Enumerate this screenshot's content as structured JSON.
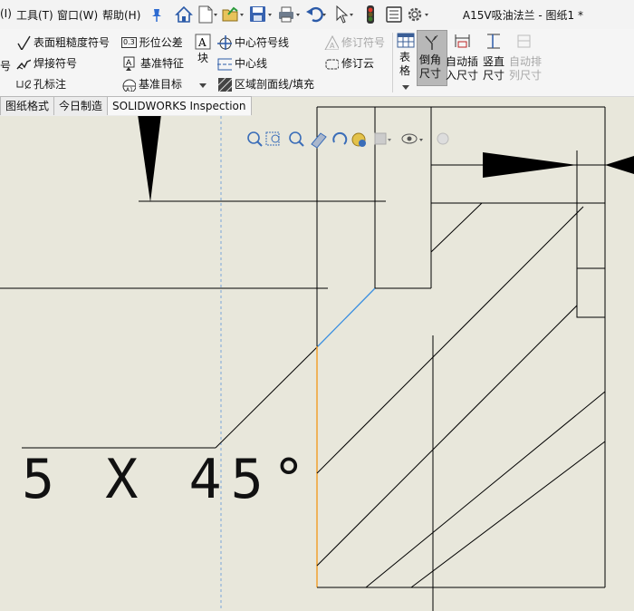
{
  "menubar": {
    "items": [
      "(I)",
      "工具(T)",
      "窗口(W)",
      "帮助(H)"
    ],
    "title": "A15V吸油法兰 - 图纸1 *"
  },
  "annotation": {
    "surface_finish": "表面粗糙度符号",
    "weld": "焊接符号",
    "hole_callout": "孔标注",
    "partial_left": "号",
    "gtol": "形位公差",
    "datum_feature": "基准特征",
    "datum_target": "基准目标",
    "block": "块",
    "centermark": "中心符号线",
    "centerline": "中心线",
    "area_hatch": "区域剖面线/填充",
    "revision_symbol": "修订符号",
    "revision_cloud": "修订云",
    "table_1": "表",
    "table_2": "格",
    "chamfer_1": "倒角",
    "chamfer_2": "尺寸",
    "auto_insert_1": "自动插",
    "auto_insert_2": "入尺寸",
    "vertical_1": "竖直",
    "vertical_2": "尺寸",
    "auto_arrange_1": "自动排",
    "auto_arrange_2": "列尺寸",
    "gtol_icon_label": "0.3"
  },
  "tabs": [
    "图纸格式",
    "今日制造",
    "SOLIDWORKS Inspection"
  ],
  "drawing": {
    "chamfer_dimension": "5 X 45°"
  },
  "colors": {
    "sheet_background": "#e8e7db",
    "selected_edge": "#f0a030",
    "selected_leader": "#3a8fe0",
    "active_button": "#b8b8b8"
  }
}
